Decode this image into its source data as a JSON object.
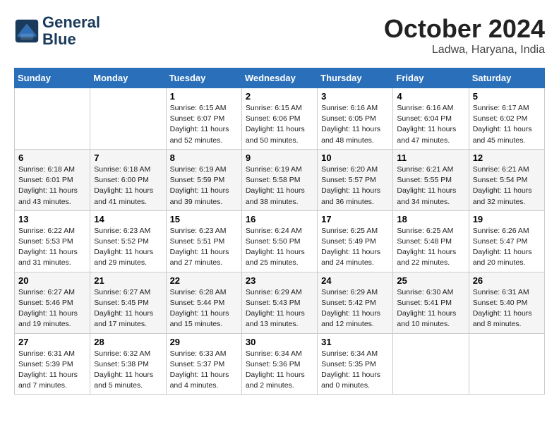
{
  "header": {
    "logo_line1": "General",
    "logo_line2": "Blue",
    "month": "October 2024",
    "location": "Ladwa, Haryana, India"
  },
  "days_of_week": [
    "Sunday",
    "Monday",
    "Tuesday",
    "Wednesday",
    "Thursday",
    "Friday",
    "Saturday"
  ],
  "weeks": [
    [
      {
        "day": "",
        "info": ""
      },
      {
        "day": "",
        "info": ""
      },
      {
        "day": "1",
        "info": "Sunrise: 6:15 AM\nSunset: 6:07 PM\nDaylight: 11 hours and 52 minutes."
      },
      {
        "day": "2",
        "info": "Sunrise: 6:15 AM\nSunset: 6:06 PM\nDaylight: 11 hours and 50 minutes."
      },
      {
        "day": "3",
        "info": "Sunrise: 6:16 AM\nSunset: 6:05 PM\nDaylight: 11 hours and 48 minutes."
      },
      {
        "day": "4",
        "info": "Sunrise: 6:16 AM\nSunset: 6:04 PM\nDaylight: 11 hours and 47 minutes."
      },
      {
        "day": "5",
        "info": "Sunrise: 6:17 AM\nSunset: 6:02 PM\nDaylight: 11 hours and 45 minutes."
      }
    ],
    [
      {
        "day": "6",
        "info": "Sunrise: 6:18 AM\nSunset: 6:01 PM\nDaylight: 11 hours and 43 minutes."
      },
      {
        "day": "7",
        "info": "Sunrise: 6:18 AM\nSunset: 6:00 PM\nDaylight: 11 hours and 41 minutes."
      },
      {
        "day": "8",
        "info": "Sunrise: 6:19 AM\nSunset: 5:59 PM\nDaylight: 11 hours and 39 minutes."
      },
      {
        "day": "9",
        "info": "Sunrise: 6:19 AM\nSunset: 5:58 PM\nDaylight: 11 hours and 38 minutes."
      },
      {
        "day": "10",
        "info": "Sunrise: 6:20 AM\nSunset: 5:57 PM\nDaylight: 11 hours and 36 minutes."
      },
      {
        "day": "11",
        "info": "Sunrise: 6:21 AM\nSunset: 5:55 PM\nDaylight: 11 hours and 34 minutes."
      },
      {
        "day": "12",
        "info": "Sunrise: 6:21 AM\nSunset: 5:54 PM\nDaylight: 11 hours and 32 minutes."
      }
    ],
    [
      {
        "day": "13",
        "info": "Sunrise: 6:22 AM\nSunset: 5:53 PM\nDaylight: 11 hours and 31 minutes."
      },
      {
        "day": "14",
        "info": "Sunrise: 6:23 AM\nSunset: 5:52 PM\nDaylight: 11 hours and 29 minutes."
      },
      {
        "day": "15",
        "info": "Sunrise: 6:23 AM\nSunset: 5:51 PM\nDaylight: 11 hours and 27 minutes."
      },
      {
        "day": "16",
        "info": "Sunrise: 6:24 AM\nSunset: 5:50 PM\nDaylight: 11 hours and 25 minutes."
      },
      {
        "day": "17",
        "info": "Sunrise: 6:25 AM\nSunset: 5:49 PM\nDaylight: 11 hours and 24 minutes."
      },
      {
        "day": "18",
        "info": "Sunrise: 6:25 AM\nSunset: 5:48 PM\nDaylight: 11 hours and 22 minutes."
      },
      {
        "day": "19",
        "info": "Sunrise: 6:26 AM\nSunset: 5:47 PM\nDaylight: 11 hours and 20 minutes."
      }
    ],
    [
      {
        "day": "20",
        "info": "Sunrise: 6:27 AM\nSunset: 5:46 PM\nDaylight: 11 hours and 19 minutes."
      },
      {
        "day": "21",
        "info": "Sunrise: 6:27 AM\nSunset: 5:45 PM\nDaylight: 11 hours and 17 minutes."
      },
      {
        "day": "22",
        "info": "Sunrise: 6:28 AM\nSunset: 5:44 PM\nDaylight: 11 hours and 15 minutes."
      },
      {
        "day": "23",
        "info": "Sunrise: 6:29 AM\nSunset: 5:43 PM\nDaylight: 11 hours and 13 minutes."
      },
      {
        "day": "24",
        "info": "Sunrise: 6:29 AM\nSunset: 5:42 PM\nDaylight: 11 hours and 12 minutes."
      },
      {
        "day": "25",
        "info": "Sunrise: 6:30 AM\nSunset: 5:41 PM\nDaylight: 11 hours and 10 minutes."
      },
      {
        "day": "26",
        "info": "Sunrise: 6:31 AM\nSunset: 5:40 PM\nDaylight: 11 hours and 8 minutes."
      }
    ],
    [
      {
        "day": "27",
        "info": "Sunrise: 6:31 AM\nSunset: 5:39 PM\nDaylight: 11 hours and 7 minutes."
      },
      {
        "day": "28",
        "info": "Sunrise: 6:32 AM\nSunset: 5:38 PM\nDaylight: 11 hours and 5 minutes."
      },
      {
        "day": "29",
        "info": "Sunrise: 6:33 AM\nSunset: 5:37 PM\nDaylight: 11 hours and 4 minutes."
      },
      {
        "day": "30",
        "info": "Sunrise: 6:34 AM\nSunset: 5:36 PM\nDaylight: 11 hours and 2 minutes."
      },
      {
        "day": "31",
        "info": "Sunrise: 6:34 AM\nSunset: 5:35 PM\nDaylight: 11 hours and 0 minutes."
      },
      {
        "day": "",
        "info": ""
      },
      {
        "day": "",
        "info": ""
      }
    ]
  ]
}
